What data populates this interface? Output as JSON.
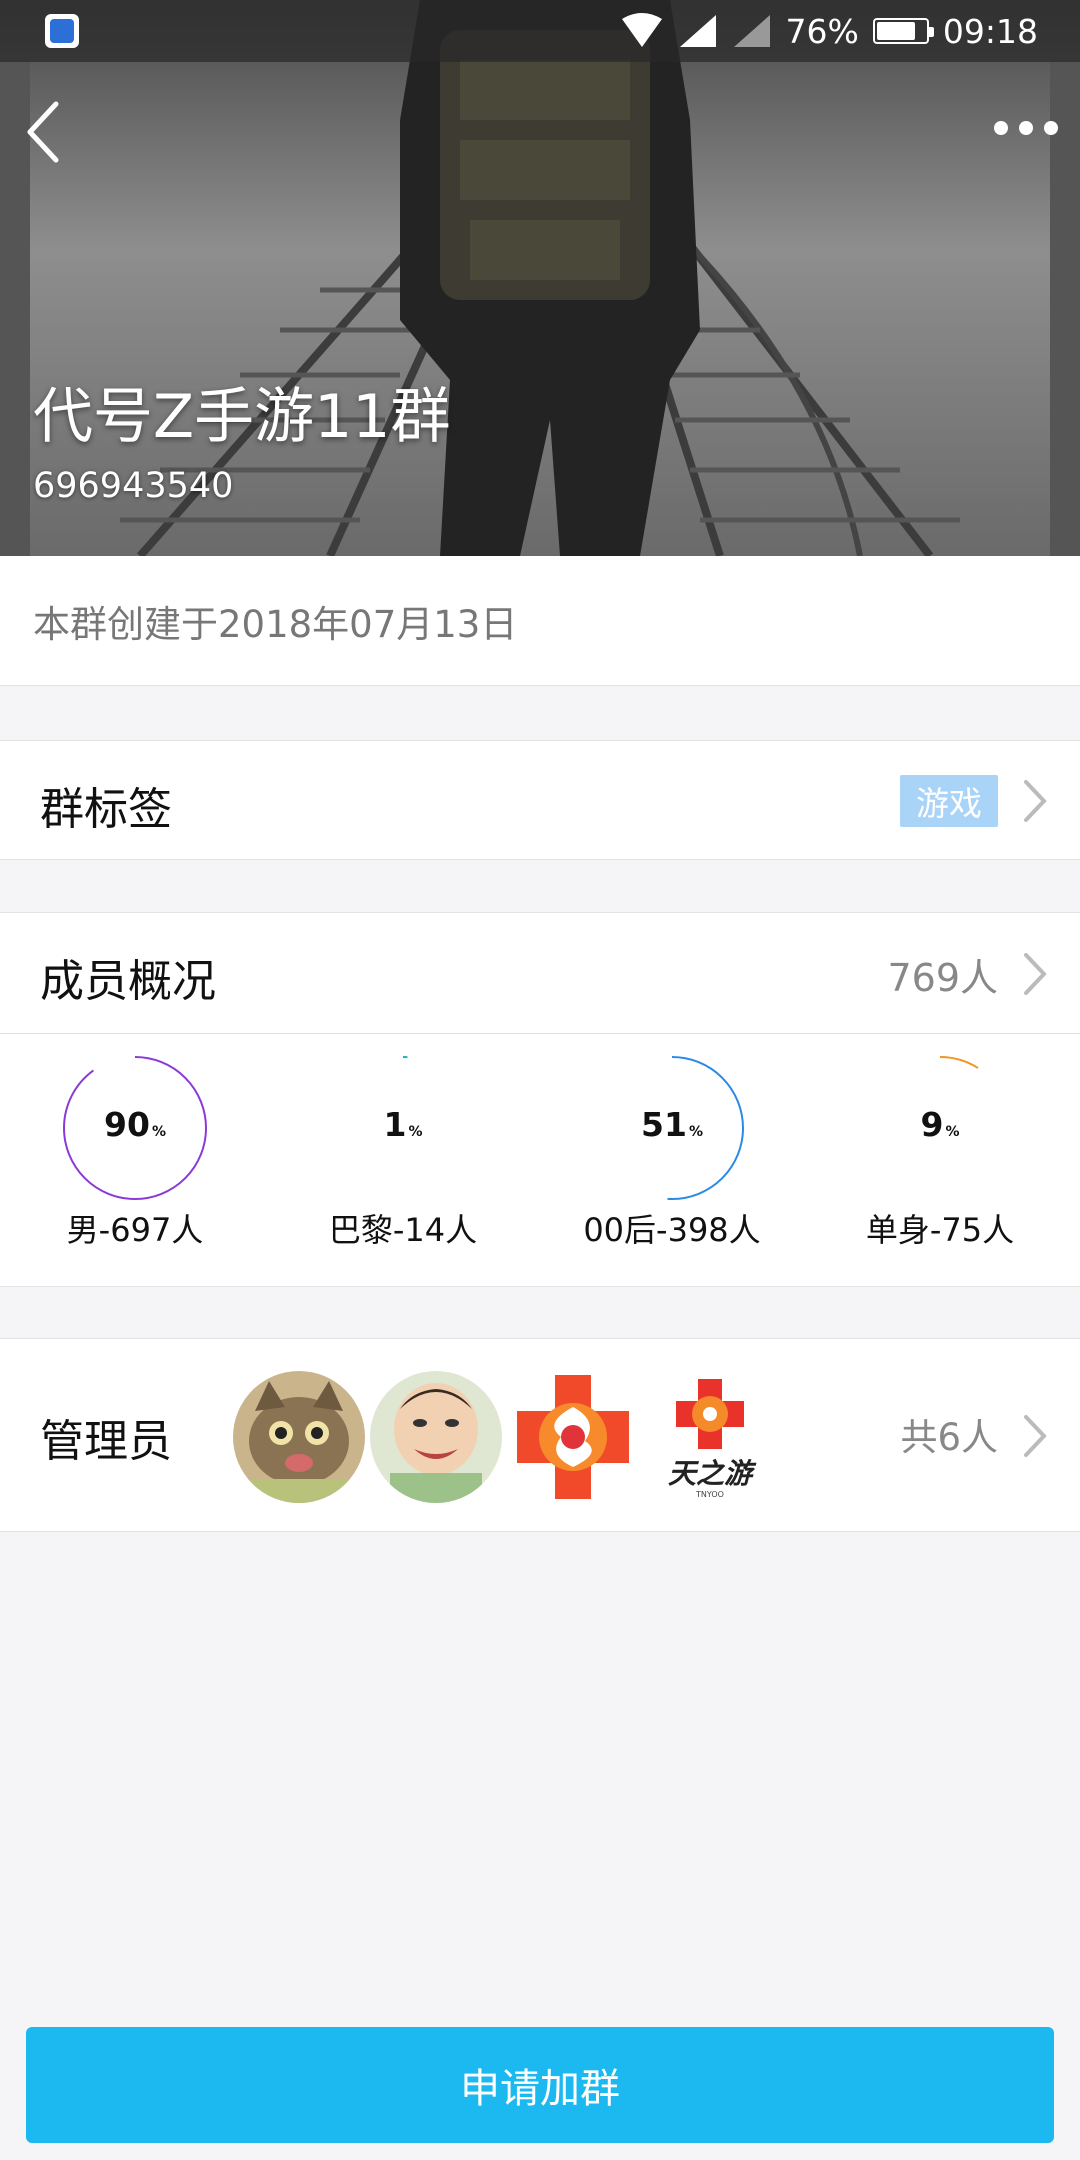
{
  "status_bar": {
    "battery": "76%",
    "time": "09:18"
  },
  "header": {
    "group_name": "代号Z手游11群",
    "group_id": "696943540"
  },
  "created": {
    "text": "本群创建于2018年07月13日"
  },
  "tags": {
    "title": "群标签",
    "badge": "游戏"
  },
  "members": {
    "title": "成员概况",
    "count": "769人",
    "stats": [
      {
        "percent": 90,
        "label": "男-697人",
        "color": "#8a3ad8"
      },
      {
        "percent": 1,
        "label": "巴黎-14人",
        "color": "#19b6c6"
      },
      {
        "percent": 51,
        "label": "00后-398人",
        "color": "#2b8ae6"
      },
      {
        "percent": 9,
        "label": "单身-75人",
        "color": "#f29624"
      }
    ]
  },
  "admins": {
    "title": "管理员",
    "count": "共6人",
    "avatars": [
      "cat-avatar",
      "baby-avatar",
      "logo-avatar",
      "tianzhiyou-logo-avatar"
    ]
  },
  "footer": {
    "join_label": "申请加群"
  },
  "colors": {
    "accent": "#1bb9f0",
    "tag_bg": "#a9d4f7"
  }
}
